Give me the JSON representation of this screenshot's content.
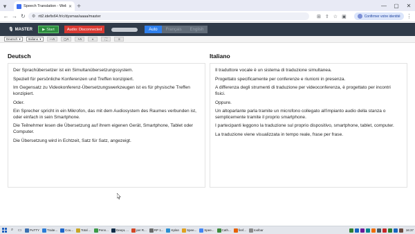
{
  "browser": {
    "tab_title": "Speech Translation - Web Versi",
    "new_tab": "+",
    "url": "rtt2.idefix64.fr/c/dysmas/aaaa/master",
    "identity_label": "Confirmer votre identité",
    "window_controls": [
      "—",
      "▢",
      "✕"
    ]
  },
  "app": {
    "brand": "MASTER",
    "start_label": "Start",
    "audio_status": "Audio: Disconnected",
    "languages": [
      {
        "label": "Auto",
        "active": true
      },
      {
        "label": "Français",
        "active": false
      },
      {
        "label": "English",
        "active": false
      }
    ]
  },
  "controls": {
    "source_lang": "Deutsch",
    "target_lang": "Italiano",
    "buttons": [
      "—A",
      "▢A",
      "+A",
      "◐",
      "⛶",
      "≡"
    ]
  },
  "panes": {
    "left": {
      "title": "Deutsch",
      "paragraphs": [
        "Der Sprachübersetzer ist ein Simultanübersetzungssystem.",
        "Speziell für persönliche Konferenzen und Treffen konzipiert.",
        "Im Gegensatz zu Videokonferenz-Übersetzungswerkzeugen ist es für physische Treffen konzipiert.",
        "Oder.",
        "Ein Sprecher spricht in ein Mikrofon, das mit dem Audiosystem des Raumes verbunden ist, oder einfach in sein Smartphone.",
        "Die Teilnehmer lesen die Übersetzung auf ihrem eigenen Gerät, Smartphone, Tablet oder Computer.",
        "Die Übersetzung wird in Echtzeit, Satz für Satz, angezeigt."
      ]
    },
    "right": {
      "title": "Italiano",
      "paragraphs": [
        "Il traduttore vocale è un sistema di traduzione simultanea.",
        "Progettato specificamente per conferenze e riunioni in presenza.",
        "A differenza degli strumenti di traduzione per videoconferenza, è progettato per incontri fisici.",
        "Oppure.",
        "Un altoparlante parla tramite un microfono collegato all'impianto audio della stanza o semplicemente tramite il proprio smartphone.",
        "I partecipanti leggono la traduzione sul proprio dispositivo, smartphone, tablet, computer.",
        "La traduzione viene visualizzata in tempo reale, frase per frase."
      ]
    }
  },
  "taskbar": {
    "apps": [
      {
        "label": "PuTTY",
        "color": "#3a6fb0"
      },
      {
        "label": "Traite...",
        "color": "#2b7bd6"
      },
      {
        "label": "Cou...",
        "color": "#1e66c9"
      },
      {
        "label": "Total ...",
        "color": "#c7a526"
      },
      {
        "label": "Penn...",
        "color": "#3a9a46"
      },
      {
        "label": "DeepL ...",
        "color": "#0f2b46"
      },
      {
        "label": "per R...",
        "color": "#d24726"
      },
      {
        "label": "RP 1...",
        "color": "#6b6b6b"
      },
      {
        "label": "Kplan",
        "color": "#2a8fd0"
      },
      {
        "label": "Spee...",
        "color": "#e0a020"
      },
      {
        "label": "Spee...",
        "color": "#4285f4"
      },
      {
        "label": "Cath...",
        "color": "#3d8b3d"
      },
      {
        "label": "firef...",
        "color": "#e66000"
      },
      {
        "label": "toolbar",
        "color": "#8a8a8a"
      }
    ],
    "tray_colors": [
      "#2e7d32",
      "#1565c0",
      "#6a1b9a",
      "#00838f",
      "#ef6c00",
      "#455a64",
      "#c62828",
      "#2e7d32",
      "#1565c0",
      "#6d4c41"
    ],
    "clock": "16:37"
  }
}
